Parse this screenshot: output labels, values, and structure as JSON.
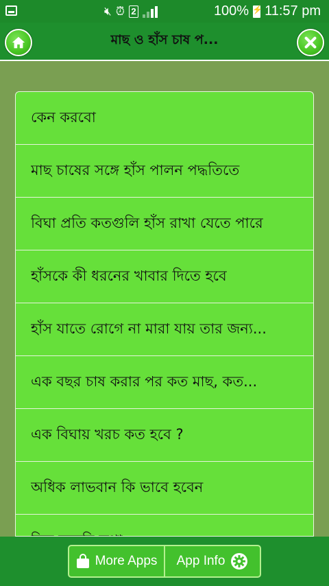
{
  "status_bar": {
    "sim_slot": "2",
    "battery": "100%",
    "time": "11:57 pm"
  },
  "header": {
    "title": "মাছ ও হাঁস চাষ প..."
  },
  "list": {
    "items": [
      {
        "label": "কেন করবো"
      },
      {
        "label": "মাছ চাষের সঙ্গে হাঁস পালন পদ্ধতিতে"
      },
      {
        "label": "বিঘা প্রতি কতগুলি হাঁস রাখা যেতে পারে"
      },
      {
        "label": "হাঁসকে কী ধরনের খাবার দিতে হবে"
      },
      {
        "label": "হাঁস যাতে রোগে না মারা যায় তার জন্য..."
      },
      {
        "label": "এক বছর চাষ করার পর কত মাছ, কত..."
      },
      {
        "label": "এক বিঘায় খরচ কত হবে ?"
      },
      {
        "label": "অধিক লাভবান কি ভাবে হবেন"
      },
      {
        "label": "কিছু জরুরি কথা"
      }
    ]
  },
  "bottom_bar": {
    "more_apps_label": "More Apps",
    "app_info_label": "App Info"
  },
  "colors": {
    "status_bar": "#1d8a2a",
    "header": "#1e8f2d",
    "list_bg": "#66e03a",
    "page_bg": "#7a9f52"
  }
}
